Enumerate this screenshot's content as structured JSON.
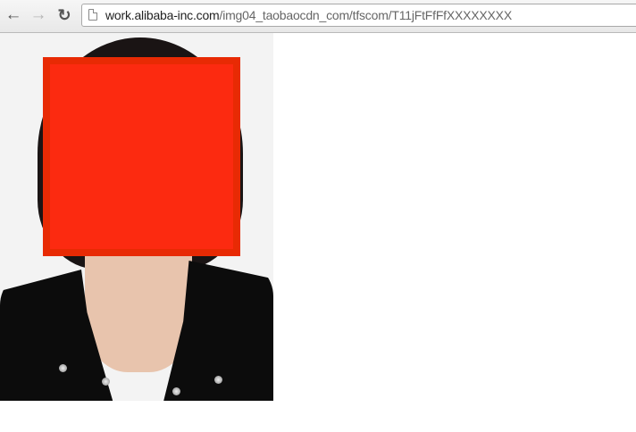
{
  "browser": {
    "url_host": "work.alibaba-inc.com",
    "url_path": "/img04_taobaocdn_com/tfscom/T11jFtFfFfXXXXXXXX",
    "back_icon": "arrow-left",
    "forward_icon": "arrow-right",
    "reload_icon": "reload",
    "page_icon": "document"
  },
  "content": {
    "image": "portrait photo with face redacted",
    "redaction_color": "#fc2a10"
  }
}
